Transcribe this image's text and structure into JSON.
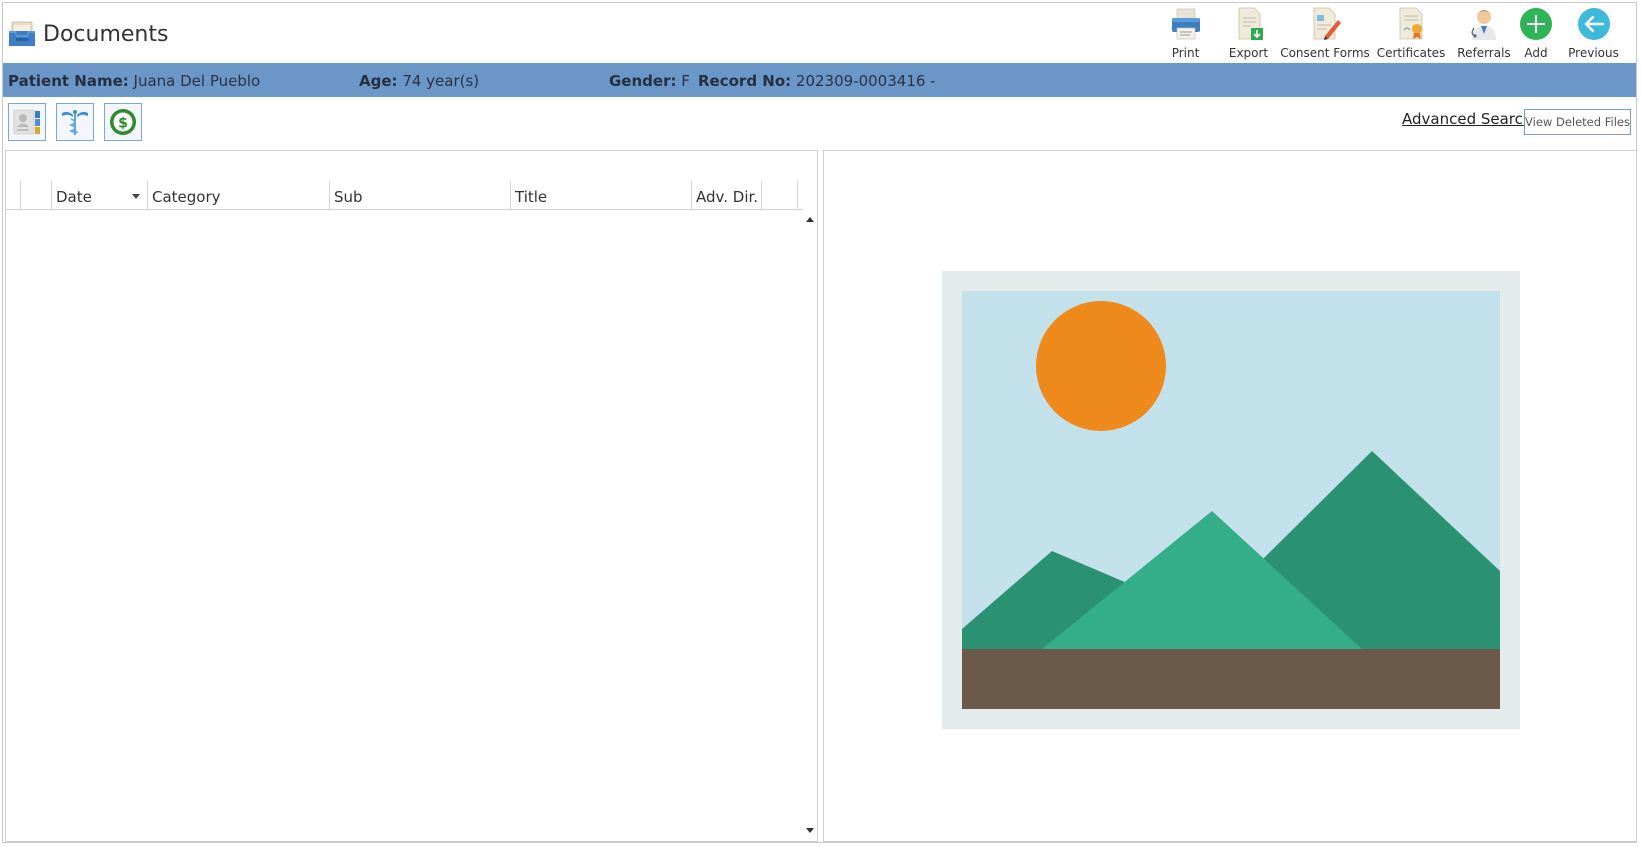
{
  "window": {
    "title": "Documents"
  },
  "toolbar": {
    "items": [
      {
        "label": "Print",
        "icon": "printer-icon"
      },
      {
        "label": "Export",
        "icon": "export-document-icon"
      },
      {
        "label": "Consent Forms",
        "icon": "consent-form-icon"
      },
      {
        "label": "Certificates",
        "icon": "certificate-icon"
      },
      {
        "label": "Referrals",
        "icon": "referral-doctor-icon"
      },
      {
        "label": "Add",
        "icon": "plus-circle-icon"
      },
      {
        "label": "Previous",
        "icon": "back-arrow-icon"
      }
    ]
  },
  "patient": {
    "name_label": "Patient Name:",
    "name": "Juana Del Pueblo",
    "age_label": "Age:",
    "age": "74 year(s)",
    "gender_label": "Gender:",
    "gender": "F",
    "record_label": "Record No:",
    "record": "202309-0003416 -"
  },
  "filters": [
    {
      "icon": "patient-demographics-icon"
    },
    {
      "icon": "caduceus-medical-icon"
    },
    {
      "icon": "dollar-billing-icon"
    }
  ],
  "actions": {
    "advanced_search": "Advanced Search",
    "view_deleted": "View Deleted Files"
  },
  "grid": {
    "columns": [
      "Date",
      "Category",
      "Sub",
      "Title",
      "Adv. Dir."
    ],
    "rows": []
  },
  "preview": {
    "icon": "image-placeholder-icon"
  },
  "colors": {
    "patient_bar": "#6b96c8",
    "sky": "#c3e1eb",
    "sun": "#ee8a1c",
    "mountain_dark": "#2a9173",
    "mountain_light": "#34ae88",
    "ground": "#6b5a4a"
  }
}
